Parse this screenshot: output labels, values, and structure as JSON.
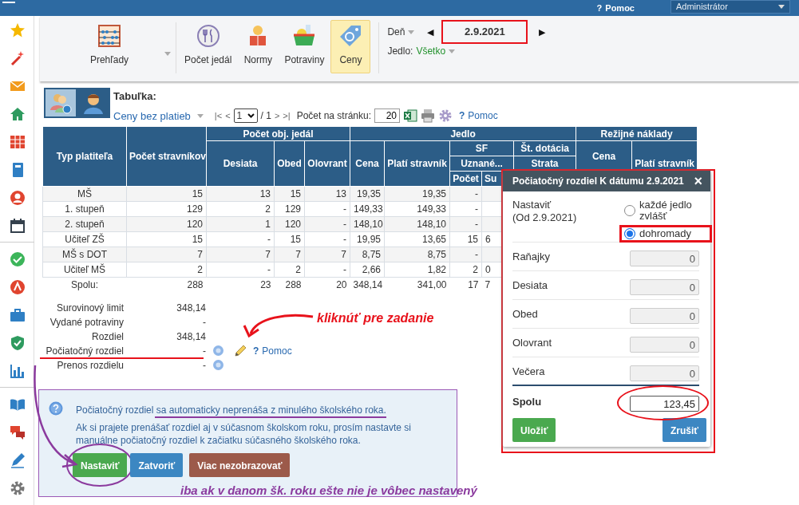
{
  "top_bar": {
    "help_glyph": "?",
    "help": "Pomoc",
    "user": "Administrátor"
  },
  "toolbar": {
    "overview": "Prehľady",
    "modules": [
      {
        "label": "Počet jedál",
        "selected": false
      },
      {
        "label": "Normy",
        "selected": false
      },
      {
        "label": "Potraviny",
        "selected": false
      },
      {
        "label": "Ceny",
        "selected": true
      }
    ]
  },
  "date_nav": {
    "day_label": "Deň",
    "prev": "◀",
    "date": "2.9.2021",
    "highlighted": true,
    "next": "▶",
    "meal_label": "Jedlo:",
    "meal_value": "Všetko"
  },
  "view": {
    "view_icons": [
      {
        "selected": true
      },
      {
        "selected": false
      }
    ],
    "table_label": "Tabuľka:",
    "view_select": "Ceny bez platieb",
    "first": "|<",
    "prev": "<",
    "page": "1",
    "page_total": "/ 1",
    "next": ">",
    "last": ">|",
    "per_page_label": "Počet na stránku:",
    "per_page": "20",
    "help_glyph": "?",
    "help": "Pomoc"
  },
  "table": {
    "header": [
      "Typ platiteľa",
      "Počet stravníkov",
      "Počet obj. jedál",
      "Jedlo",
      "Režijné náklady",
      "Desiata",
      "Obed",
      "Olovrant",
      "Cena",
      "Platí stravník",
      "SF",
      "Št. dotácia",
      "Cena",
      "Uznané...",
      "Strata",
      "Platí stravník",
      "Počet",
      "Su"
    ],
    "rows": [
      [
        "MŠ",
        "15",
        "13",
        "15",
        "13",
        "19,35",
        "19,35",
        "-",
        ""
      ],
      [
        "1. stupeň",
        "129",
        "2",
        "129",
        "-",
        "149,33",
        "149,33",
        "-",
        ""
      ],
      [
        "2. stupeň",
        "120",
        "1",
        "120",
        "-",
        "148,10",
        "148,10",
        "-",
        ""
      ],
      [
        "Učiteľ ZŠ",
        "15",
        "-",
        "15",
        "-",
        "19,95",
        "13,65",
        "15",
        "6"
      ],
      [
        "MŠ s DOT",
        "7",
        "7",
        "7",
        "7",
        "8,75",
        "8,75",
        "-",
        ""
      ],
      [
        "Učiteľ MŠ",
        "2",
        "-",
        "2",
        "-",
        "2,66",
        "1,82",
        "2",
        "0"
      ]
    ],
    "total": [
      "Spolu:",
      "288",
      "23",
      "288",
      "20",
      "348,14",
      "341,00",
      "17",
      "7"
    ]
  },
  "summary": [
    {
      "label": "Surovinový limit",
      "value": "348,14",
      "info": false,
      "edit": false,
      "underlined": false
    },
    {
      "label": "Vydané potraviny",
      "value": "-",
      "info": false,
      "edit": false,
      "underlined": false
    },
    {
      "label": "Rozdiel",
      "value": "348,14",
      "info": false,
      "edit": false,
      "underlined": false
    },
    {
      "label": "Počiatočný rozdiel",
      "value": "-",
      "info": true,
      "edit": true,
      "help_glyph": "?",
      "help": "Pomoc",
      "underlined": true
    },
    {
      "label": "Prenos rozdielu",
      "value": "-",
      "info": true,
      "edit": false,
      "underlined": false
    }
  ],
  "notice": {
    "outlined": true,
    "underlined": true,
    "text": "Počiatočný rozdiel sa automaticky neprenáša z minulého školského roka.",
    "detail": "Ak si prajete prenášať rozdiel aj v súčasnom školskom roku, prosím nastavte si manuálne počiatočný rozdiel k začiatku súčasného školského roka.",
    "buttons": [
      {
        "label": "Nastaviť",
        "kind": "success",
        "circled": true
      },
      {
        "label": "Zatvoriť",
        "kind": "primary",
        "circled": false
      },
      {
        "label": "Viac nezobrazovať",
        "kind": "danger",
        "circled": false
      }
    ]
  },
  "dialog": {
    "highlighted": true,
    "title": "Počiatočný rozdiel K dátumu 2.9.2021",
    "close": "×",
    "mode_label": "Nastaviť",
    "mode_sub": "(Od 2.9.2021)",
    "options": [
      {
        "label": "každé jedlo zvlášť",
        "selected": false,
        "highlighted": false
      },
      {
        "label": "dohromady",
        "selected": true,
        "highlighted": true
      }
    ],
    "fields": [
      {
        "label": "Raňajky",
        "value": "0",
        "disabled": true
      },
      {
        "label": "Desiata",
        "value": "0",
        "disabled": true
      },
      {
        "label": "Obed",
        "value": "0",
        "disabled": true
      },
      {
        "label": "Olovrant",
        "value": "0",
        "disabled": true
      },
      {
        "label": "Večera",
        "value": "0",
        "disabled": true
      }
    ],
    "total": {
      "label": "Spolu",
      "value": "123,45",
      "disabled": false,
      "circled": true
    },
    "save": "Uložiť",
    "cancel": "Zrušiť"
  },
  "annotations": [
    {
      "text": "kliknúť pre zadanie",
      "color": "#e8121b"
    },
    {
      "text": "iba ak v danom šk. roku ešte nie je vôbec nastavený",
      "color": "#8b3a9e"
    }
  ]
}
